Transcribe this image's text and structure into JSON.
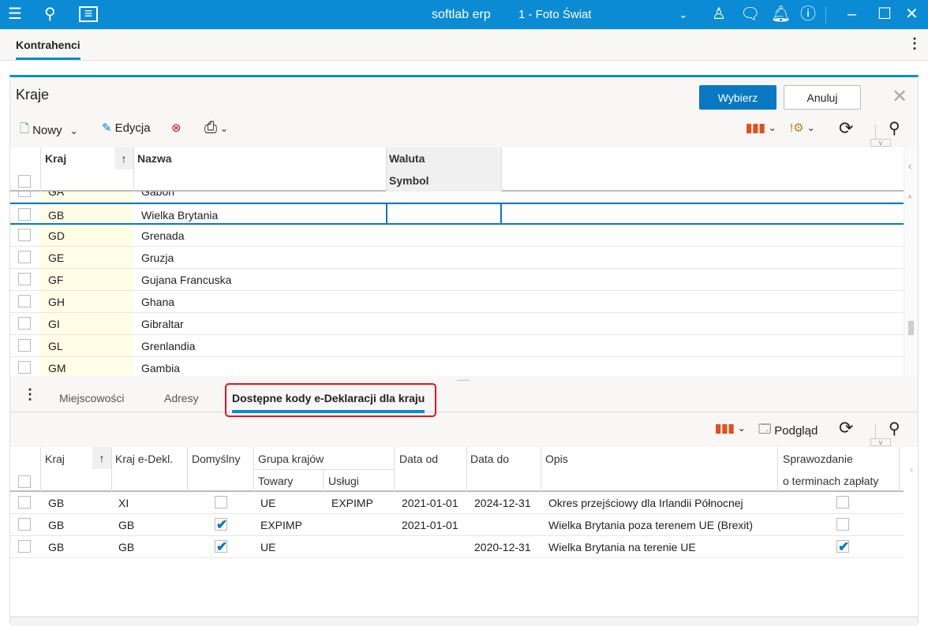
{
  "titlebar": {
    "app_name": "softlab erp",
    "company": "1 - Foto Świat"
  },
  "tabbar": {
    "active_tab": "Kontrahenci"
  },
  "dialog": {
    "title": "Kraje",
    "select_button": "Wybierz",
    "cancel_button": "Anuluj"
  },
  "toolbar": {
    "new_label": "Nowy",
    "edit_label": "Edycja"
  },
  "upper_grid": {
    "headers": {
      "code": "Kraj",
      "name": "Nazwa",
      "currency": "Waluta",
      "symbol": "Symbol"
    },
    "rows": [
      {
        "code": "GA",
        "name": "Gabon"
      },
      {
        "code": "GB",
        "name": "Wielka Brytania",
        "selected": true
      },
      {
        "code": "GD",
        "name": "Grenada"
      },
      {
        "code": "GE",
        "name": "Gruzja"
      },
      {
        "code": "GF",
        "name": "Gujana Francuska"
      },
      {
        "code": "GH",
        "name": "Ghana"
      },
      {
        "code": "GI",
        "name": "Gibraltar"
      },
      {
        "code": "GL",
        "name": "Grenlandia"
      },
      {
        "code": "GM",
        "name": "Gambia"
      }
    ]
  },
  "subtabs": [
    "Miejscowości",
    "Adresy",
    "Dostępne kody e-Deklaracji dla kraju"
  ],
  "lower_toolbar": {
    "preview_label": "Podgląd"
  },
  "lower_grid": {
    "headers": {
      "country": "Kraj",
      "edecl": "Kraj e-Dekl.",
      "default": "Domyślny",
      "group": "Grupa krajów",
      "goods": "Towary",
      "services": "Usługi",
      "date_from": "Data od",
      "date_to": "Data do",
      "desc": "Opis",
      "report1": "Sprawozdanie",
      "report2": "o terminach zapłaty"
    },
    "rows": [
      {
        "country": "GB",
        "edecl": "XI",
        "default": false,
        "goods": "UE",
        "services": "EXPIMP",
        "date_from": "2021-01-01",
        "date_to": "2024-12-31",
        "desc": "Okres przejściowy dla Irlandii Północnej",
        "report": false
      },
      {
        "country": "GB",
        "edecl": "GB",
        "default": true,
        "goods": "EXPIMP",
        "services": "",
        "date_from": "2021-01-01",
        "date_to": "",
        "desc": "Wielka Brytania poza terenem UE (Brexit)",
        "report": false
      },
      {
        "country": "GB",
        "edecl": "GB",
        "default": true,
        "goods": "UE",
        "services": "",
        "date_from": "",
        "date_to": "2020-12-31",
        "desc": "Wielka Brytania na terenie UE",
        "report": true
      }
    ]
  },
  "colors": {
    "accent": "#0a8bd4",
    "key_column": "#fffde6",
    "highlight": "#e0141e"
  }
}
